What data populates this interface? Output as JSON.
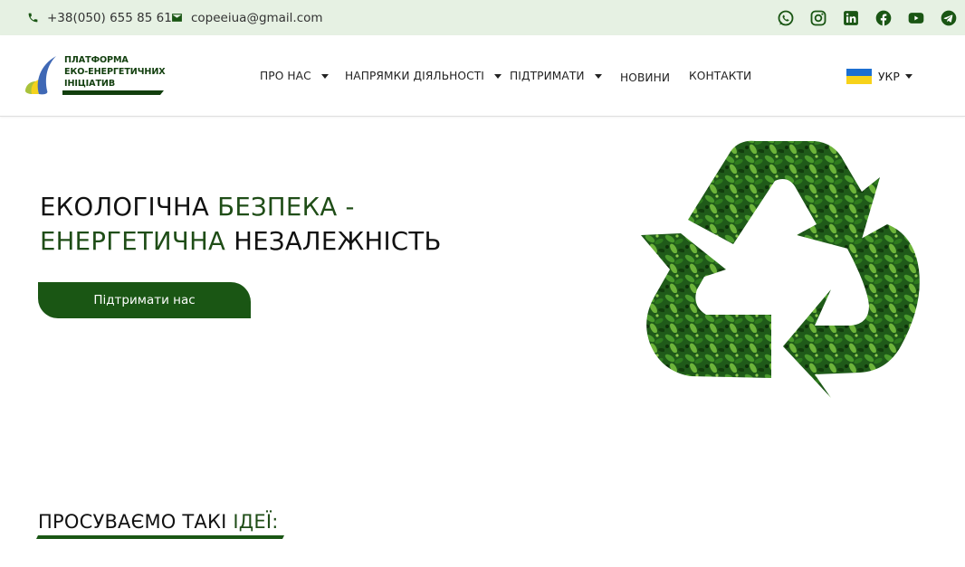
{
  "topbar": {
    "phone": "+38(050) 655 85 61",
    "email": "copeeiua@gmail.com",
    "socials": [
      "whatsapp-icon",
      "instagram-icon",
      "linkedin-icon",
      "facebook-icon",
      "youtube-icon",
      "telegram-icon"
    ]
  },
  "logo": {
    "line1": "ПЛАТФОРМА",
    "line2": "ЕКО-ЕНЕРГЕТИЧНИХ",
    "line3": "ІНІЦІАТИВ"
  },
  "nav": {
    "items": [
      {
        "label": "ПРО НАС",
        "has_dropdown": true
      },
      {
        "label": "НАПРЯМКИ ДІЯЛЬНОСТІ",
        "has_dropdown": true
      },
      {
        "label": "ПІДТРИМАТИ",
        "has_dropdown": true
      },
      {
        "label": "НОВИНИ",
        "has_dropdown": false
      },
      {
        "label": "КОНТАКТИ",
        "has_dropdown": false
      }
    ],
    "language": "УКР"
  },
  "hero": {
    "line1_a": "ЕКОЛОГІЧНА",
    "line1_b": "БЕЗПЕКА -",
    "line2_a": "ЕНЕРГЕТИЧНА",
    "line2_b": "НЕЗАЛЕЖНІСТЬ",
    "cta_label": "Підтримати нас"
  },
  "ideas": {
    "title_a": "ПРОСУВАЄМО ТАКІ",
    "title_b": "ІДЕЇ:"
  },
  "colors": {
    "topbar_bg": "#e6f1e3",
    "brand_green": "#1a5614",
    "accent_green": "#1f4d17",
    "flag_blue": "#1c6fd1",
    "flag_yellow": "#f7d21a"
  }
}
